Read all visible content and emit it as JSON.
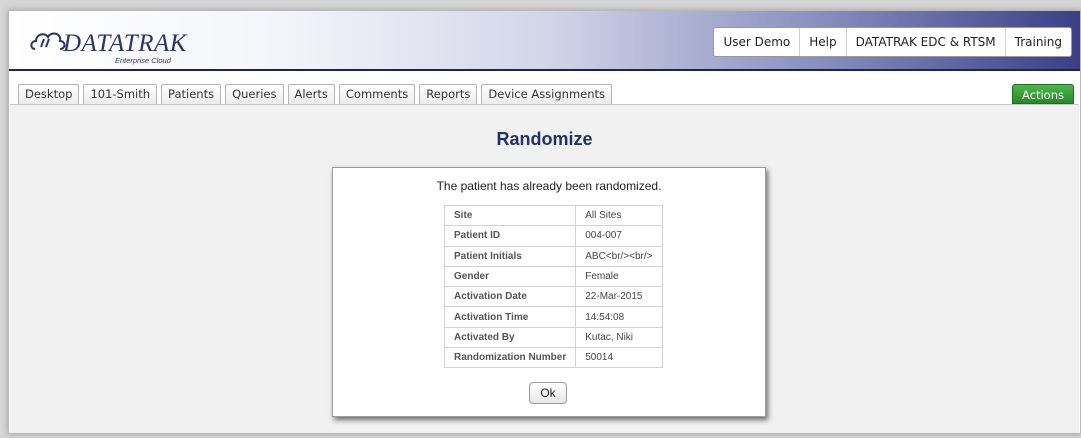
{
  "header": {
    "logo_text": "DATATRAK",
    "logo_subtitle": "Enterprise Cloud",
    "nav": [
      "User Demo",
      "Help",
      "DATATRAK EDC & RTSM",
      "Training"
    ]
  },
  "tabs": [
    "Desktop",
    "101-Smith",
    "Patients",
    "Queries",
    "Alerts",
    "Comments",
    "Reports",
    "Device Assignments"
  ],
  "actions_label": "Actions",
  "page_title": "Randomize",
  "dialog": {
    "message": "The patient has already been randomized.",
    "rows": [
      {
        "label": "Site",
        "value": "All Sites"
      },
      {
        "label": "Patient ID",
        "value": "004-007"
      },
      {
        "label": "Patient Initials",
        "value": "ABC<br/><br/>"
      },
      {
        "label": "Gender",
        "value": "Female"
      },
      {
        "label": "Activation Date",
        "value": "22-Mar-2015"
      },
      {
        "label": "Activation Time",
        "value": "14:54:08"
      },
      {
        "label": "Activated By",
        "value": "Kutac, Niki"
      },
      {
        "label": "Randomization Number",
        "value": "50014"
      }
    ],
    "ok_label": "Ok"
  },
  "colors": {
    "title_navy": "#24306d",
    "header_dark": "#3a3f86",
    "actions_green": "#268a26"
  }
}
